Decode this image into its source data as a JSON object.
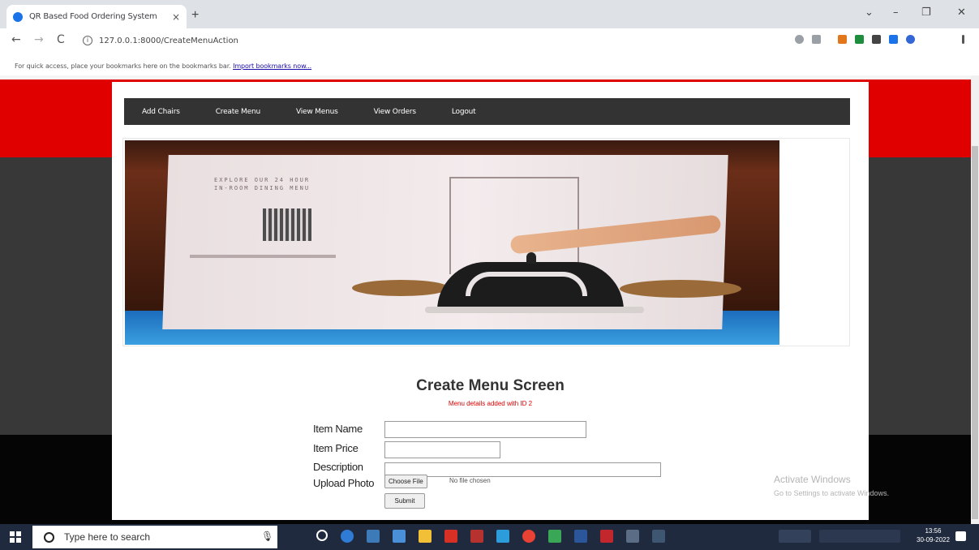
{
  "browser": {
    "tab_title": "QR Based Food Ordering System",
    "tab_close": "×",
    "new_tab": "+",
    "url": "127.0.0.1:8000/CreateMenuAction",
    "bookmarks_message": "For quick access, place your bookmarks here on the bookmarks bar.",
    "bookmarks_link": "Import bookmarks now...",
    "window_controls": [
      "⌄",
      "–",
      "❐",
      "✕"
    ],
    "nav_buttons": [
      "←",
      "→",
      "C"
    ]
  },
  "nav": {
    "items": [
      "Add Chairs",
      "Create Menu",
      "View Menus",
      "View Orders",
      "Logout"
    ]
  },
  "banner": {
    "menu_card_text": "EXPLORE OUR 24 HOUR\nIN-ROOM DINING MENU"
  },
  "form": {
    "title": "Create Menu Screen",
    "message": "Menu details added with ID 2",
    "labels": {
      "item_name": "Item Name",
      "item_price": "Item Price",
      "description": "Description",
      "upload_photo": "Upload Photo"
    },
    "values": {
      "item_name": "",
      "item_price": "",
      "description": ""
    },
    "file_button": "Choose File",
    "file_status": "No file chosen",
    "submit": "Submit"
  },
  "watermark": {
    "title": "Activate Windows",
    "subtitle": "Go to Settings to activate Windows."
  },
  "taskbar": {
    "search_placeholder": "Type here to search",
    "time": "13:56",
    "date": "30-09-2022"
  },
  "colors": {
    "header_red": "#e10000",
    "nav_bg": "#333333",
    "message_red": "#e00000",
    "taskbar": "#1f2a3e"
  }
}
